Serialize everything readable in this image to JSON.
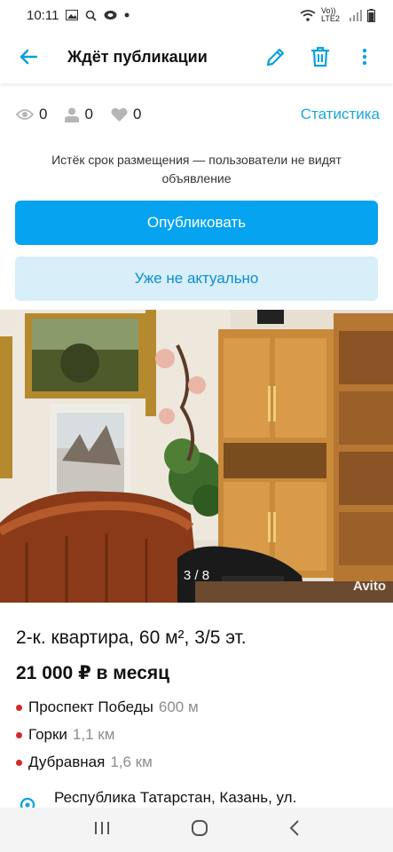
{
  "status_bar": {
    "time": "10:11",
    "network": "Vo)) LTE2"
  },
  "app_bar": {
    "title": "Ждёт публикации"
  },
  "stats": {
    "views": "0",
    "contacts": "0",
    "favorites": "0",
    "link": "Статистика"
  },
  "notice": "Истёк срок размещения — пользователи не видят объявление",
  "buttons": {
    "publish": "Опубликовать",
    "not_actual": "Уже не актуально"
  },
  "photo": {
    "counter": "3 / 8",
    "watermark": "Avito"
  },
  "listing": {
    "title": "2-к. квартира, 60 м², 3/5 эт.",
    "price": "21 000 ₽ в месяц",
    "metro": [
      {
        "name": "Проспект Победы",
        "distance": "600 м"
      },
      {
        "name": "Горки",
        "distance": "1,1 км"
      },
      {
        "name": "Дубравная",
        "distance": "1,6 км"
      }
    ],
    "address": "Республика Татарстан, Казань, ул."
  },
  "colors": {
    "accent": "#05a3f0",
    "link": "#1aa6d8",
    "metro_dot": "#d32a2a"
  }
}
